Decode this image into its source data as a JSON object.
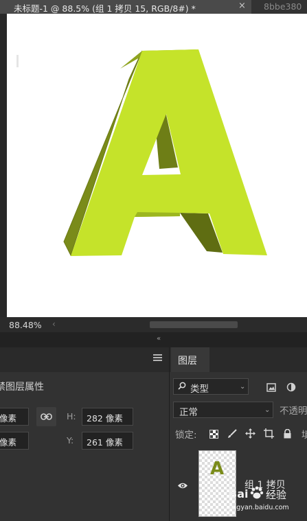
{
  "document_tabs": {
    "active_title": "未标题-1 @ 88.5% (组 1 拷贝 15, RGB/8#) *",
    "close_glyph": "×",
    "inactive_title": "8bbe380"
  },
  "canvas": {
    "background": "#ffffff",
    "letter_front_color": "#c5e32a",
    "letter_side_color": "#7a8b1a",
    "letter_dark_side_color": "#5f6d12"
  },
  "status_bar": {
    "zoom": "88.48%",
    "scroll_left_glyph": "‹"
  },
  "collapse_glyph": "«",
  "properties_panel": {
    "menu_icon": "hamburger-icon",
    "title": "禁图层属性",
    "w_value": "像素",
    "h_label": "H:",
    "h_value": "282 像素",
    "x_value": "像素",
    "y_label": "Y:",
    "y_value": "261 像素"
  },
  "layers_panel": {
    "tab": "图层",
    "filter_icon": "search-icon",
    "filter_type": "类型",
    "blend_mode": "正常",
    "opacity_label": "不透明",
    "lock_label": "锁定:",
    "fill_label": "填",
    "layer": {
      "name": "组 1 拷贝",
      "thumbnail_letter": "A"
    }
  },
  "watermark": {
    "brand_left": "Bai",
    "brand_right": "经验",
    "url": "jingyan.baidu.com"
  }
}
